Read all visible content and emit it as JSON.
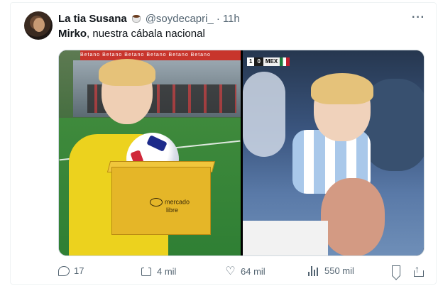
{
  "tweet": {
    "author_name": "La tia Susana",
    "author_emoji": "coffee-cup-emoji",
    "handle": "@soydecapri_",
    "separator": "·",
    "time": "11h",
    "text_bold": "Mirko",
    "text_rest": ", nuestra cábala nacional",
    "more_label": "···"
  },
  "media": {
    "left_image": {
      "banner_text": "Betano    Betano    Betano    Betano    Betano    Betano",
      "box_text_line1": "mercado",
      "box_text_line2": "libre"
    },
    "right_image": {
      "score_home": "1",
      "score_sep": "0",
      "score_away": "MEX"
    }
  },
  "actions": {
    "replies": "17",
    "reposts": "4 mil",
    "likes": "64 mil",
    "views": "550 mil"
  },
  "colors": {
    "text_primary": "#0f1419",
    "text_secondary": "#536471",
    "border": "#cfd9de"
  }
}
